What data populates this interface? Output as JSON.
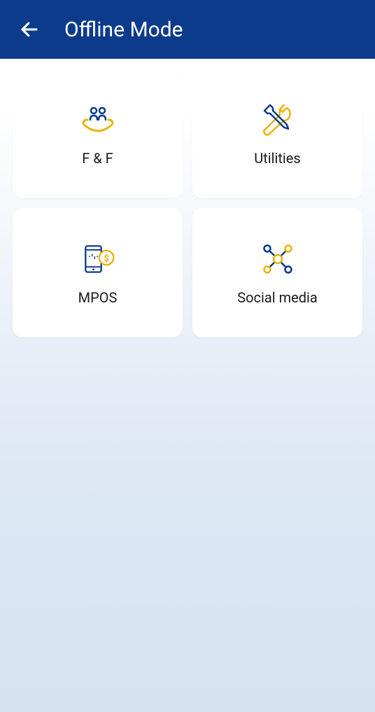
{
  "header": {
    "title": "Offline Mode"
  },
  "cards": [
    {
      "label": "F & F",
      "icon": "friends"
    },
    {
      "label": "Utilities",
      "icon": "tools"
    },
    {
      "label": "MPOS",
      "icon": "phone-pay"
    },
    {
      "label": "Social media",
      "icon": "network"
    }
  ]
}
